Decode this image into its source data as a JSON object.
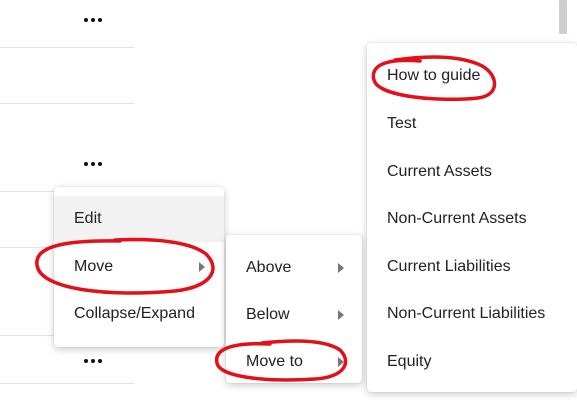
{
  "context_menu": {
    "items": [
      {
        "label": "Edit"
      },
      {
        "label": "Move"
      },
      {
        "label": "Collapse/Expand"
      }
    ]
  },
  "move_submenu": {
    "items": [
      {
        "label": "Above"
      },
      {
        "label": "Below"
      },
      {
        "label": "Move to"
      }
    ]
  },
  "move_to_submenu": {
    "items": [
      {
        "label": "How to guide"
      },
      {
        "label": "Test"
      },
      {
        "label": "Current Assets"
      },
      {
        "label": "Non-Current Assets"
      },
      {
        "label": "Current Liabilities"
      },
      {
        "label": "Non-Current Liabilities"
      },
      {
        "label": "Equity"
      }
    ]
  },
  "annotation_color": "#e3101a"
}
